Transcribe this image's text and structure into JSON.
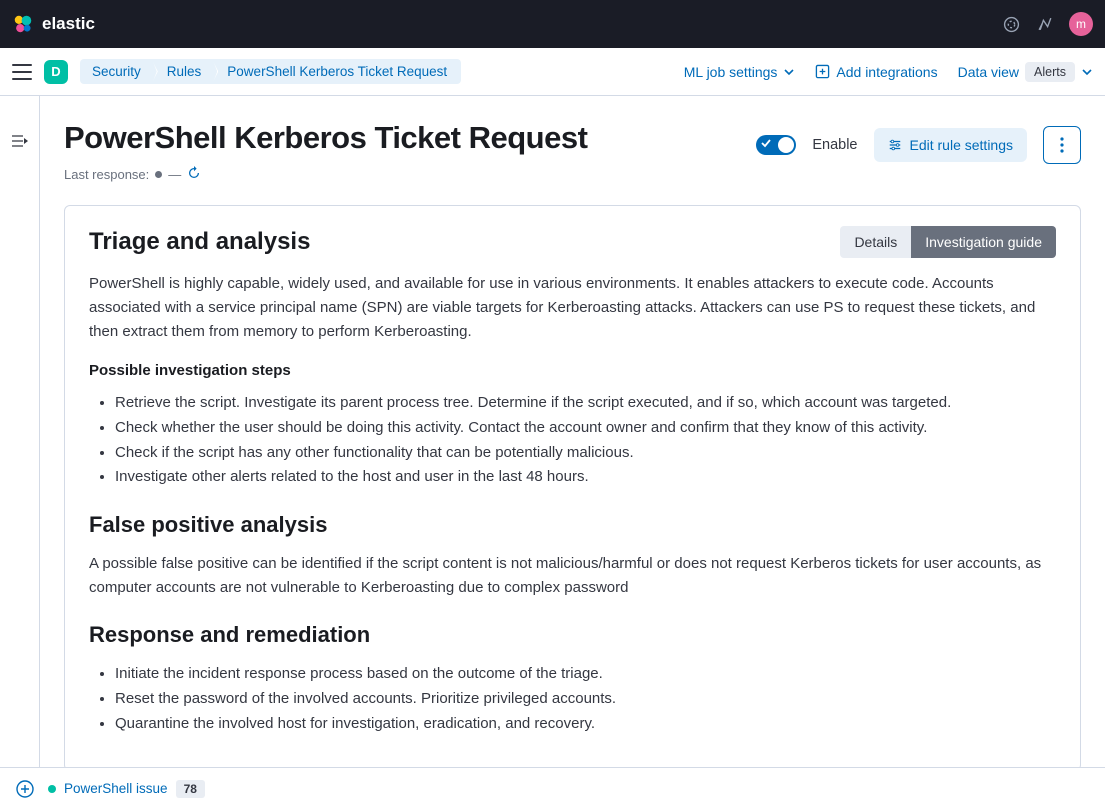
{
  "header": {
    "logo_text": "elastic",
    "avatar_initial": "m"
  },
  "breadcrumb": {
    "space": "D",
    "items": [
      "Security",
      "Rules",
      "PowerShell Kerberos Ticket Request"
    ]
  },
  "nav": {
    "ml_job": "ML job settings",
    "add_integrations": "Add integrations",
    "data_view": "Data view",
    "alerts_badge": "Alerts"
  },
  "page": {
    "title": "PowerShell Kerberos Ticket Request",
    "last_response_label": "Last response:",
    "dash": "—",
    "enable_label": "Enable",
    "edit_button": "Edit rule settings"
  },
  "panel": {
    "title": "Triage and analysis",
    "tabs": {
      "details": "Details",
      "guide": "Investigation guide"
    },
    "intro": "PowerShell is highly capable, widely used, and available for use in various environments. It enables attackers to execute code. Accounts associated with a service principal name (SPN) are viable targets for Kerberoasting attacks. Attackers can use PS to request these tickets, and then extract them from memory to perform Kerberoasting.",
    "steps_title": "Possible investigation steps",
    "steps": [
      "Retrieve the script. Investigate its parent process tree. Determine if the script executed, and if so, which account was targeted.",
      "Check whether the user should be doing this activity. Contact the account owner and confirm that they know of this activity.",
      "Check if the script has any other functionality that can be potentially malicious.",
      "Investigate other alerts related to the host and user in the last 48 hours."
    ],
    "fp_title": "False positive analysis",
    "fp_text": "A possible false positive can be identified if the script content is not malicious/harmful or does not request Kerberos tickets for user accounts, as computer accounts are not vulnerable to Kerberoasting due to complex password",
    "rr_title": "Response and remediation",
    "rr_steps": [
      "Initiate the incident response process based on the outcome of the triage.",
      "Reset the password of the involved accounts. Prioritize privileged accounts.",
      "Quarantine the involved host for investigation, eradication, and recovery."
    ]
  },
  "footer": {
    "timeline_label": "PowerShell issue",
    "count": "78"
  }
}
